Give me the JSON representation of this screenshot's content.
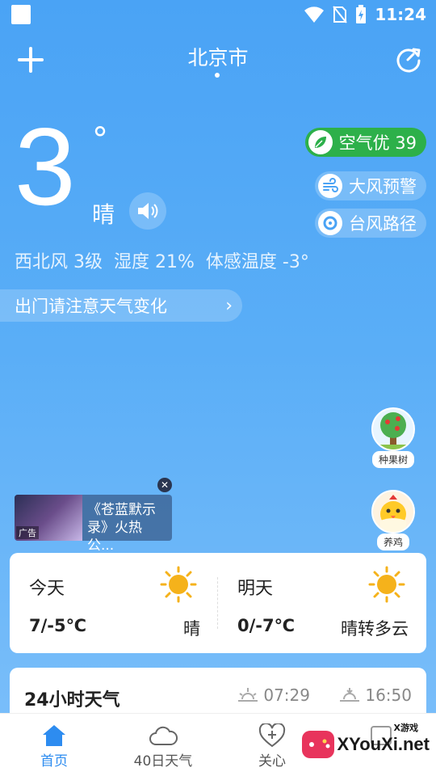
{
  "status_bar": {
    "time": "11:24"
  },
  "header": {
    "city": "北京市"
  },
  "current": {
    "temperature": "3",
    "degree_symbol": "°",
    "condition": "晴",
    "wind": "西北风 3级",
    "humidity": "湿度 21%",
    "feels_like": "体感温度 -3°",
    "tip": "出门请注意天气变化"
  },
  "pills": {
    "air": "空气优 39",
    "wind_warning": "大风预警",
    "typhoon": "台风路径"
  },
  "side_games": {
    "tree_label": "种果树",
    "chick_label": "养鸡"
  },
  "ad": {
    "tag": "广告",
    "text": "《苍蓝默示录》火热公..."
  },
  "days": [
    {
      "name": "今天",
      "range": "7/-5℃",
      "desc": "晴"
    },
    {
      "name": "明天",
      "range": "0/-7℃",
      "desc": "晴转多云"
    }
  ],
  "hourly": {
    "title": "24小时天气",
    "sunrise": "07:29",
    "sunset": "16:50"
  },
  "nav": {
    "home": "首页",
    "forty_day": "40日天气",
    "care": "关心"
  },
  "watermark": {
    "text": "XYouXi.net",
    "small": "X游戏"
  },
  "colors": {
    "air_good": "#2db04a",
    "nav_active": "#2d8cf0",
    "sun": "#f5b21b"
  }
}
